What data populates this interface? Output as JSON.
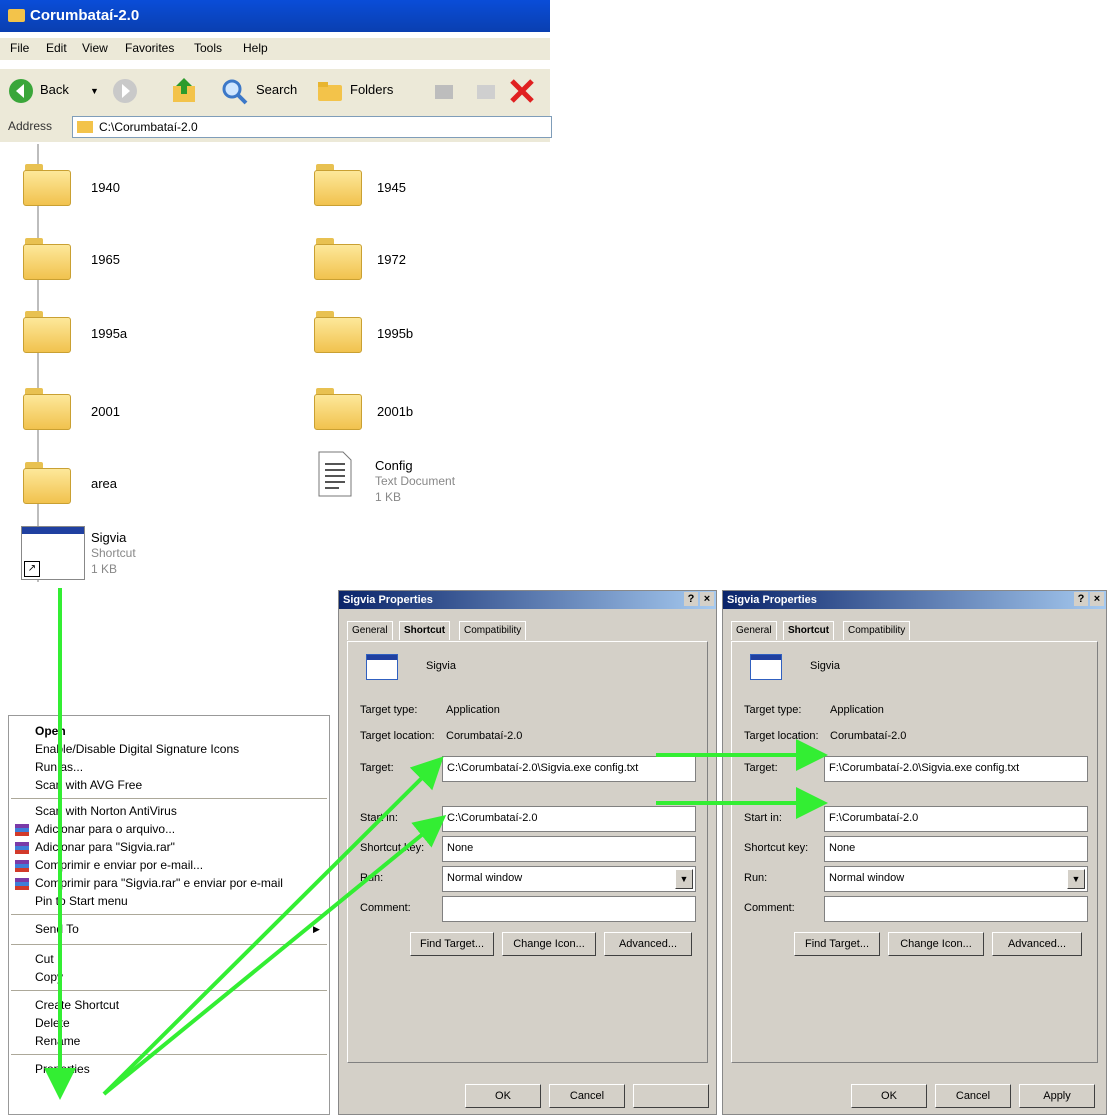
{
  "explorer": {
    "title": "Corumbataí-2.0",
    "menu": [
      "File",
      "Edit",
      "View",
      "Favorites",
      "Tools",
      "Help"
    ],
    "toolbar": {
      "back": "Back",
      "search": "Search",
      "folders": "Folders"
    },
    "address_label": "Address",
    "address_value": "C:\\Corumbataí-2.0",
    "items": [
      {
        "name": "1940",
        "type": "folder"
      },
      {
        "name": "1945",
        "type": "folder"
      },
      {
        "name": "1965",
        "type": "folder"
      },
      {
        "name": "1972",
        "type": "folder"
      },
      {
        "name": "1995a",
        "type": "folder"
      },
      {
        "name": "1995b",
        "type": "folder"
      },
      {
        "name": "2001",
        "type": "folder"
      },
      {
        "name": "2001b",
        "type": "folder"
      },
      {
        "name": "area",
        "type": "folder"
      },
      {
        "name": "Config",
        "type": "text",
        "subtitle": "Text Document",
        "size": "1 KB"
      },
      {
        "name": "Sigvia",
        "type": "shortcut",
        "subtitle": "Shortcut",
        "size": "1 KB"
      }
    ]
  },
  "context_menu": {
    "items": [
      "Open",
      "Enable/Disable Digital Signature Icons",
      "Run as...",
      "Scan with AVG Free",
      "Scan with Norton AntiVirus",
      "Adicionar para o arquivo...",
      "Adicionar para \"Sigvia.rar\"",
      "Comprimir e enviar por e-mail...",
      "Comprimir para \"Sigvia.rar\" e enviar por e-mail",
      "Pin to Start menu",
      "Send To",
      "Cut",
      "Copy",
      "Create Shortcut",
      "Delete",
      "Rename",
      "Properties"
    ]
  },
  "dialog_left": {
    "title": "Sigvia Properties",
    "tabs": [
      "General",
      "Shortcut",
      "Compatibility"
    ],
    "name": "Sigvia",
    "target_type_label": "Target type:",
    "target_type": "Application",
    "target_location_label": "Target location:",
    "target_location": "Corumbataí-2.0",
    "target_label": "Target:",
    "target": "C:\\Corumbataí-2.0\\Sigvia.exe config.txt",
    "start_in_label": "Start in:",
    "start_in": "C:\\Corumbataí-2.0",
    "shortcut_key_label": "Shortcut key:",
    "shortcut_key": "None",
    "run_label": "Run:",
    "run": "Normal window",
    "comment_label": "Comment:",
    "comment": "",
    "find_target": "Find Target...",
    "change_icon": "Change Icon...",
    "advanced": "Advanced...",
    "ok": "OK",
    "cancel": "Cancel",
    "apply": ""
  },
  "dialog_right": {
    "title": "Sigvia Properties",
    "tabs": [
      "General",
      "Shortcut",
      "Compatibility"
    ],
    "name": "Sigvia",
    "target_type_label": "Target type:",
    "target_type": "Application",
    "target_location_label": "Target location:",
    "target_location": "Corumbataí-2.0",
    "target_label": "Target:",
    "target": "F:\\Corumbataí-2.0\\Sigvia.exe config.txt",
    "start_in_label": "Start in:",
    "start_in": "F:\\Corumbataí-2.0",
    "shortcut_key_label": "Shortcut key:",
    "shortcut_key": "None",
    "run_label": "Run:",
    "run": "Normal window",
    "comment_label": "Comment:",
    "comment": "",
    "find_target": "Find Target...",
    "change_icon": "Change Icon...",
    "advanced": "Advanced...",
    "ok": "OK",
    "cancel": "Cancel",
    "apply": "Apply"
  },
  "colors": {
    "arrow": "#33ee33",
    "xp_title": "#0a4dd8",
    "dialog_bg": "#d4d0c8"
  }
}
